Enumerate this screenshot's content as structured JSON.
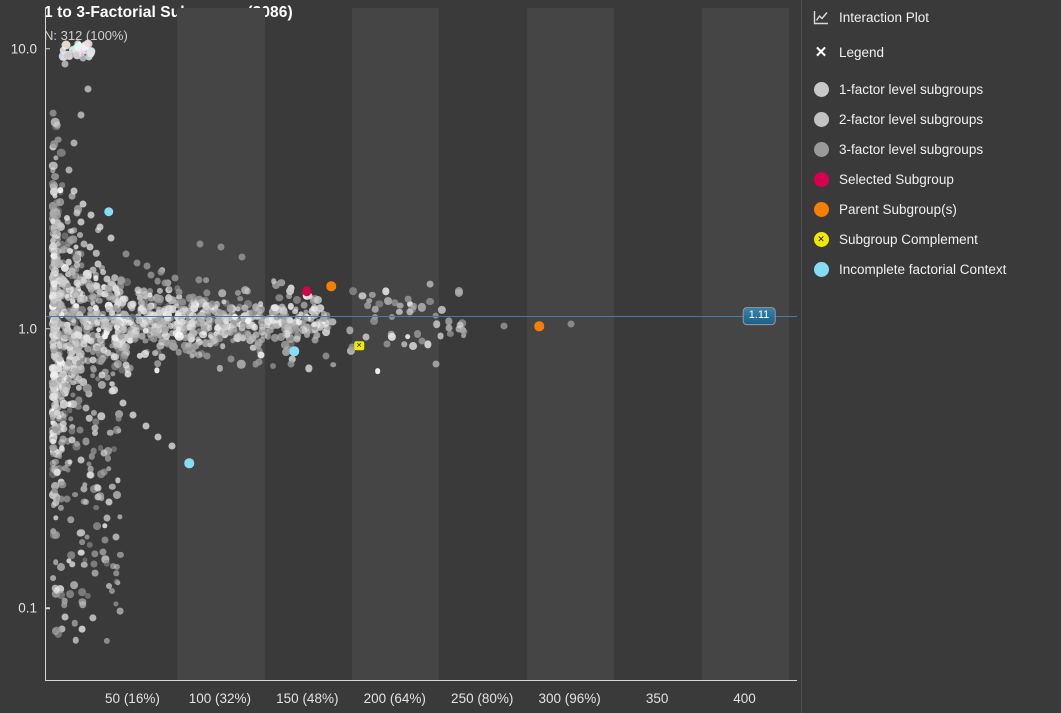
{
  "plot": {
    "title": "1 to 3-Factorial Subgroups (3086)",
    "subtitle": "N: 312 (100%)",
    "reference_value": "1.11"
  },
  "side_panel": {
    "header": {
      "interaction_plot_label": "Interaction Plot",
      "interaction_plot_icon": "line-chart-icon",
      "legend_label": "Legend",
      "legend_close_icon": "close-icon"
    },
    "legend_items": [
      {
        "label": "1-factor level subgroups",
        "color": "#c9c9c9",
        "marker": "circle"
      },
      {
        "label": "2-factor level subgroups",
        "color": "#c2c2c2",
        "marker": "circle"
      },
      {
        "label": "3-factor level subgroups",
        "color": "#9a9a9a",
        "marker": "circle"
      },
      {
        "label": "Selected Subgroup",
        "color": "#d6004f",
        "marker": "circle"
      },
      {
        "label": "Parent Subgroup(s)",
        "color": "#f77f00",
        "marker": "circle"
      },
      {
        "label": "Subgroup Complement",
        "color": "#f2e800",
        "marker": "circle-x",
        "glyph": "✕"
      },
      {
        "label": "Incomplete factorial Context",
        "color": "#87dcf5",
        "marker": "circle"
      }
    ]
  },
  "chart_data": {
    "type": "scatter",
    "title": "1 to 3-Factorial Subgroups (3086)",
    "subtitle": "N: 312 (100%)",
    "xlabel": "",
    "ylabel": "",
    "yscale": "log",
    "ylim": [
      0.055,
      14.0
    ],
    "xlim": [
      0,
      430
    ],
    "grid": false,
    "legend_position": "right-panel",
    "y_ticks": [
      {
        "value": 10.0,
        "label": "10.0"
      },
      {
        "value": 1.0,
        "label": "1.0"
      },
      {
        "value": 0.1,
        "label": "0.1"
      }
    ],
    "x_ticks": [
      {
        "value": 50,
        "label": "50 (16%)"
      },
      {
        "value": 100,
        "label": "100 (32%)"
      },
      {
        "value": 150,
        "label": "150 (48%)"
      },
      {
        "value": 200,
        "label": "200 (64%)"
      },
      {
        "value": 250,
        "label": "250 (80%)"
      },
      {
        "value": 300,
        "label": "300 (96%)"
      },
      {
        "value": 350,
        "label": "350"
      },
      {
        "value": 400,
        "label": "400"
      }
    ],
    "banding": {
      "enabled": true,
      "start_x": 25,
      "band_width": 50,
      "band_color": "#454545",
      "base_color": "#3a3a3a"
    },
    "reference_line": {
      "value": 1.11,
      "label": "1.11",
      "color": "#3d7fa6",
      "orientation": "horizontal"
    },
    "series": [
      {
        "name": "1-factor level subgroups",
        "color": "#c9c9c9",
        "points": [
          [
            13,
            3.7
          ],
          [
            16,
            4.6
          ],
          [
            20,
            5.8
          ],
          [
            24,
            7.2
          ],
          [
            18,
            2.6
          ],
          [
            22,
            2.0
          ],
          [
            27,
            1.62
          ],
          [
            31,
            1.35
          ],
          [
            36,
            1.18
          ],
          [
            42,
            1.05
          ],
          [
            48,
            0.95
          ],
          [
            15,
            0.82
          ],
          [
            19,
            0.66
          ],
          [
            23,
            0.52
          ],
          [
            28,
            0.44
          ],
          [
            33,
            0.36
          ],
          [
            11,
            8.8
          ],
          [
            12,
            9.4
          ],
          [
            14,
            9.6
          ],
          [
            17,
            9.5
          ],
          [
            21,
            9.3
          ],
          [
            26,
            0.3
          ],
          [
            30,
            0.25
          ],
          [
            35,
            0.21
          ],
          [
            40,
            0.18
          ]
        ]
      },
      {
        "name": "2-factor level subgroups",
        "color": "#dedede",
        "points": [
          [
            20,
            2.4
          ],
          [
            25,
            1.95
          ],
          [
            30,
            1.7
          ],
          [
            35,
            1.5
          ],
          [
            40,
            1.38
          ],
          [
            45,
            1.28
          ],
          [
            50,
            1.22
          ],
          [
            56,
            1.16
          ],
          [
            62,
            1.12
          ],
          [
            70,
            1.09
          ],
          [
            78,
            1.06
          ],
          [
            22,
            0.88
          ],
          [
            27,
            0.77
          ],
          [
            32,
            0.68
          ],
          [
            38,
            0.6
          ],
          [
            44,
            0.54
          ],
          [
            50,
            0.49
          ],
          [
            57,
            0.45
          ],
          [
            64,
            0.41
          ],
          [
            72,
            0.38
          ],
          [
            18,
            1.45
          ],
          [
            24,
            1.55
          ],
          [
            29,
            1.42
          ],
          [
            34,
            1.33
          ],
          [
            41,
            1.25
          ],
          [
            19,
            0.95
          ],
          [
            26,
            0.9
          ],
          [
            33,
            0.84
          ],
          [
            39,
            0.79
          ],
          [
            46,
            0.74
          ],
          [
            16,
            3.1
          ],
          [
            21,
            2.8
          ],
          [
            26,
            2.55
          ],
          [
            31,
            2.3
          ],
          [
            37,
            2.1
          ],
          [
            15,
            0.4
          ],
          [
            20,
            0.34
          ],
          [
            25,
            0.3
          ],
          [
            30,
            0.27
          ],
          [
            36,
            0.24
          ]
        ]
      },
      {
        "name": "3-factor level subgroups",
        "color": "#9a9a9a",
        "points": [
          [
            60,
            1.55
          ],
          [
            68,
            1.45
          ],
          [
            76,
            1.35
          ],
          [
            84,
            1.3
          ],
          [
            95,
            1.22
          ],
          [
            105,
            1.18
          ],
          [
            118,
            1.14
          ],
          [
            132,
            1.1
          ],
          [
            148,
            1.08
          ],
          [
            62,
            0.92
          ],
          [
            70,
            0.88
          ],
          [
            80,
            0.84
          ],
          [
            92,
            0.8
          ],
          [
            106,
            0.78
          ],
          [
            122,
            0.76
          ],
          [
            140,
            0.75
          ],
          [
            160,
            0.8
          ],
          [
            175,
            0.86
          ],
          [
            195,
            0.88
          ],
          [
            215,
            0.9
          ],
          [
            262,
            1.02
          ],
          [
            300,
            1.04
          ],
          [
            46,
            1.85
          ],
          [
            52,
            1.72
          ],
          [
            58,
            1.68
          ],
          [
            66,
            1.6
          ],
          [
            74,
            1.52
          ],
          [
            88,
            2.0
          ],
          [
            100,
            1.95
          ],
          [
            112,
            1.8
          ]
        ]
      },
      {
        "name": "Selected Subgroup",
        "color": "#d6004f",
        "points": [
          [
            149,
            1.36
          ]
        ]
      },
      {
        "name": "Parent Subgroup(s)",
        "color": "#f77f00",
        "points": [
          [
            163,
            1.42
          ],
          [
            282,
            1.02
          ]
        ]
      },
      {
        "name": "Subgroup Complement",
        "color": "#f2e800",
        "points": [
          [
            179,
            0.87
          ]
        ]
      },
      {
        "name": "Incomplete factorial Context",
        "color": "#87dcf5",
        "points": [
          [
            36,
            2.62
          ],
          [
            142,
            0.83
          ],
          [
            82,
            0.33
          ]
        ]
      }
    ]
  }
}
